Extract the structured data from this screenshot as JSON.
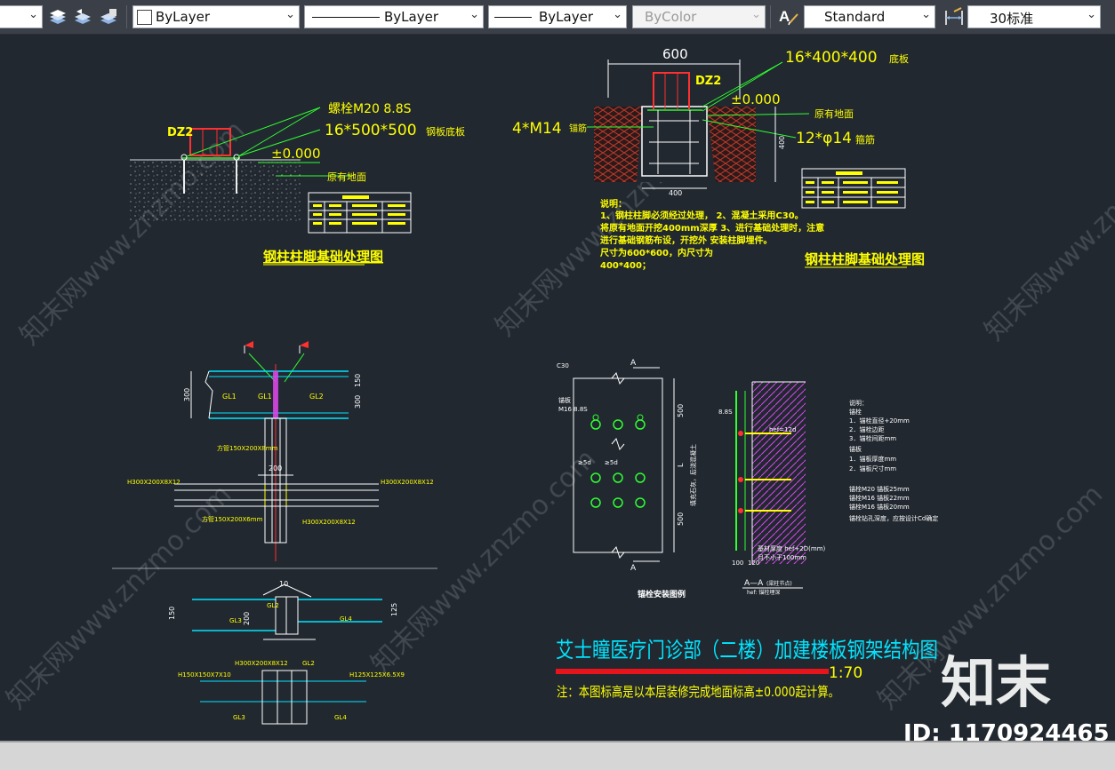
{
  "toolbar": {
    "layer_value": "ByLayer",
    "linetype_value": "ByLayer",
    "lineweight_value": "ByLayer",
    "plotstyle_value": "ByColor",
    "textstyle_value": "Standard",
    "dimstyle_value": "30标准"
  },
  "drawing": {
    "d1": {
      "tag": "DZ2",
      "bolt": "M20 8.8S",
      "bolt_prefix": "螺栓",
      "plate": "16*500*500",
      "plate_suffix": "钢板底板",
      "level": "±0.000",
      "ground": "原有地面",
      "title": "钢柱柱脚基础处理图"
    },
    "d2": {
      "dim_600": "600",
      "tag": "DZ2",
      "plate": "16*400*400",
      "plate_suffix": "底板",
      "level": "±0.000",
      "ground": "原有地面",
      "anchor": "4*M14",
      "anchor_suffix": "锚筋",
      "rebar": "12*φ14",
      "rebar_suffix": "箍筋",
      "dim_400": "400",
      "dim_400b": "400",
      "notes": [
        "说明：",
        "1、钢柱柱脚必须经过处理，  2、混凝土采用C30。",
        "将原有地面开挖400mm深厚  3、进行基础处理时，注意",
        "进行基础钢筋布设，开挖外  安装柱脚埋件。",
        "尺寸为600*600，内尺寸为",
        "400*400；"
      ],
      "title": "钢柱柱脚基础处理图"
    },
    "d3": {
      "gl1": "GL1",
      "gl1b": "GL1",
      "gl2": "GL2",
      "dim_300": "300",
      "dim_150": "150",
      "dim_300b": "300",
      "dim_200": "200",
      "h_left": "H300X200X8X12",
      "h_right": "H300X200X8X12",
      "h_mid": "H300X200X8X12",
      "note_top": "方管150X200X8mm",
      "note_bot": "方管150X200X6mm"
    },
    "d4": {
      "gl2": "GL2",
      "gl3": "GL3",
      "gl4": "GL4",
      "dim_150": "150",
      "dim_200": "200",
      "dim_125": "125",
      "h_left": "H150X150X7X10",
      "h_mid": "H300X200X8X12",
      "h_right": "H125X125X6.5X9",
      "gl2b": "GL2",
      "gl3b": "GL3",
      "gl4b": "GL4"
    },
    "d5": {
      "sec_a": "A",
      "sec_a2": "A",
      "c30": "C30",
      "plate_note": "锚板",
      "bolt_note": "M16 8.8S",
      "dim_500": "500",
      "dim_L": "L",
      "dim_500b": "500",
      "fill_note": "填充石灰，后浇混凝土",
      "e5d_a": "≥5d",
      "e5d_b": "≥5d",
      "caption": "锚栓安装图例"
    },
    "d6": {
      "section_title": "A—A",
      "section_sub": "(梁柱节点)",
      "hef_note": "hef: 锚栓埋深",
      "sect_note1": "基材厚度 hef+2D(mm)",
      "sect_note2": "且不小于100mm",
      "dim_a": "100",
      "dim_b": "120",
      "bolt": "8.8S",
      "hef_label": "hef=12d",
      "legend_title": "说明：",
      "legend": [
        "锚栓",
        "1．锚栓直径+20mm",
        "2．锚栓边距",
        "3．锚栓间距mm",
        "锚板",
        "1．锚板厚度mm",
        "2．锚板尺寸mm",
        "锚栓M20  锚板25mm",
        "锚栓M16  锚板22mm",
        "锚栓M16  锚板20mm",
        "锚栓钻孔深度，应按设计Cd确定"
      ]
    },
    "main_title": "艾士瞳医疗门诊部（二楼）加建楼板钢架结构图",
    "scale": "1:70",
    "note": "注：本图标高是以本层装修完成地面标高±0.000起计算。"
  },
  "watermark": {
    "text": "知末网www.znzmo.com",
    "logo": "知末",
    "id": "ID: 1170924465"
  }
}
